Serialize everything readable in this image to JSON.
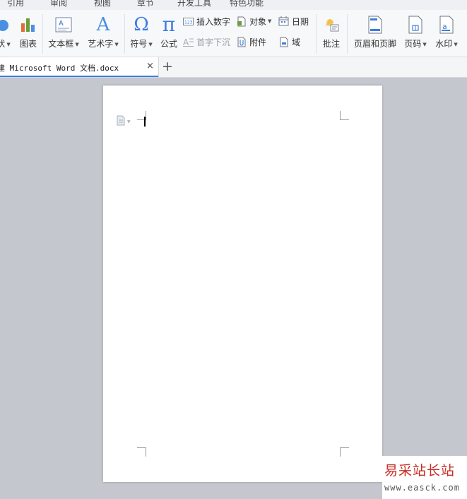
{
  "menu_tabs": [
    "引用",
    "审阅",
    "视图",
    "章节",
    "开发工具",
    "特色功能"
  ],
  "ribbon": {
    "shape_label": "状",
    "chart_label": "图表",
    "textbox_label": "文本框",
    "wordart_label": "艺术字",
    "symbol_label": "符号",
    "formula_label": "公式",
    "insert_number_label": "插入数字",
    "object_label": "对象",
    "date_label": "日期",
    "dropcap_label": "首字下沉",
    "attachment_label": "附件",
    "field_label": "域",
    "comment_label": "批注",
    "header_footer_label": "页眉和页脚",
    "page_number_label": "页码",
    "watermark_label": "水印",
    "textbox_glyph": "A",
    "wordart_glyph": "A",
    "symbol_glyph": "Ω",
    "formula_glyph": "π",
    "number_badge": "123"
  },
  "document_tab": {
    "title": "建 Microsoft Word 文档.docx",
    "close_glyph": "×",
    "new_tab_glyph": "+"
  },
  "watermark_site": {
    "name": "易采站长站",
    "url": "www.easck.com"
  },
  "colors": {
    "accent": "#3b7de0",
    "workspace": "#c4c7ce",
    "watermark_red": "#c82c24"
  }
}
